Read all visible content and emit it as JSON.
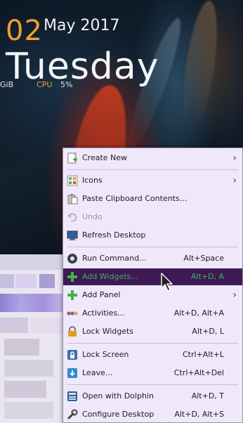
{
  "clock": {
    "day": "02",
    "month_year": "May 2017",
    "weekday": "Tuesday"
  },
  "system_monitor": {
    "ram_fragment": "GiB",
    "cpu_label": "CPU",
    "cpu_value": "5%"
  },
  "context_menu": {
    "create_new": "Create New",
    "icons": "Icons",
    "paste_clipboard": "Paste Clipboard Contents...",
    "undo": "Undo",
    "refresh_desktop": "Refresh Desktop",
    "run_command": "Run Command...",
    "run_command_shortcut": "Alt+Space",
    "add_widgets": "Add Widgets...",
    "add_widgets_shortcut": "Alt+D, A",
    "add_panel": "Add Panel",
    "activities": "Activities...",
    "activities_shortcut": "Alt+D, Alt+A",
    "lock_widgets": "Lock Widgets",
    "lock_widgets_shortcut": "Alt+D, L",
    "lock_screen": "Lock Screen",
    "lock_screen_shortcut": "Ctrl+Alt+L",
    "leave": "Leave...",
    "leave_shortcut": "Ctrl+Alt+Del",
    "open_with_dolphin": "Open with Dolphin",
    "open_with_dolphin_shortcut": "Alt+D, T",
    "configure_desktop": "Configure Desktop",
    "configure_desktop_shortcut": "Alt+D, Alt+S"
  },
  "colors": {
    "accent_orange": "#f0a030",
    "menu_background": "#efe8fb",
    "highlight_background": "#3d1a54",
    "highlight_text": "#4ca86a"
  }
}
